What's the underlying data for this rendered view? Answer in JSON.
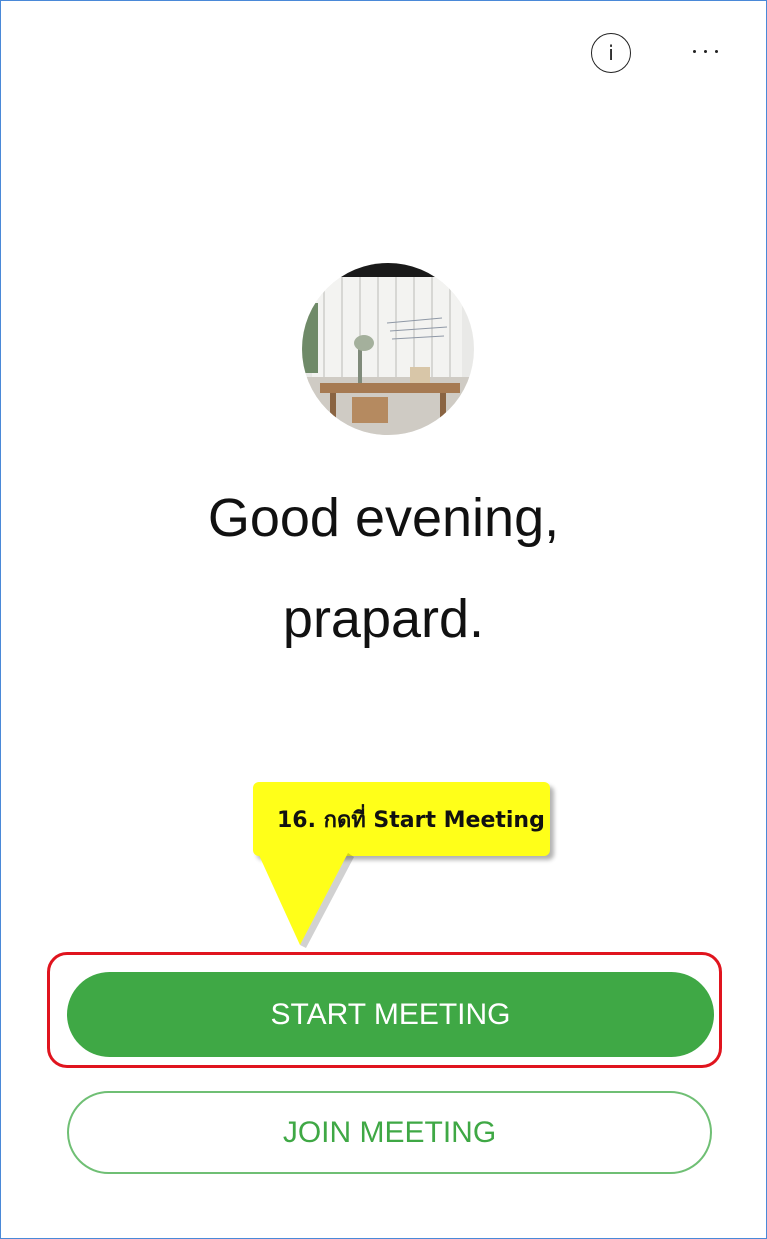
{
  "header": {
    "info_icon": "info-icon",
    "info_glyph": "i",
    "more_icon": "more-horizontal-icon"
  },
  "greeting": {
    "line1": "Good evening,",
    "line2": "prapard."
  },
  "annotation": {
    "callout_text": "16. กดที่ Start Meeting",
    "highlight_color": "#e0141e",
    "callout_color": "#ffff19"
  },
  "actions": {
    "start_label": "START MEETING",
    "join_label": "JOIN MEETING",
    "accent_color": "#3fa845"
  }
}
